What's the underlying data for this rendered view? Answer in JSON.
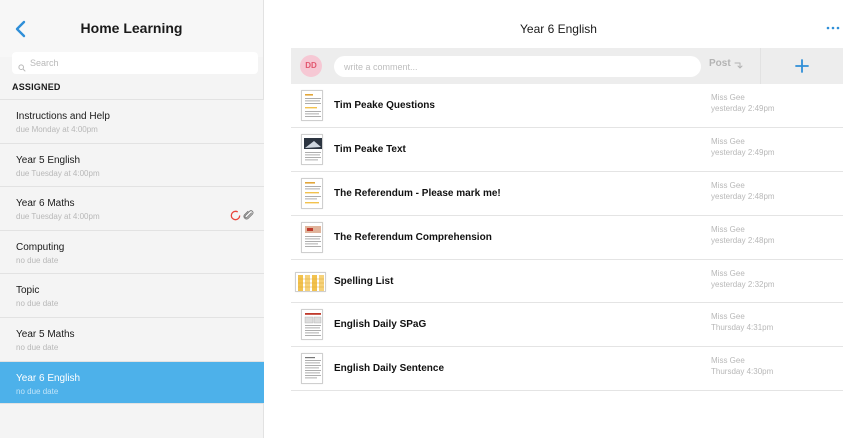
{
  "sidebar": {
    "title": "Home Learning",
    "search_placeholder": "Search",
    "section_label": "ASSIGNED",
    "items": [
      {
        "title": "Instructions and Help",
        "due": "due Monday at 4:00pm"
      },
      {
        "title": "Year 5 English",
        "due": "due Tuesday at 4:00pm"
      },
      {
        "title": "Year 6 Maths",
        "due": "due Tuesday at 4:00pm"
      },
      {
        "title": "Computing",
        "due": "no due date"
      },
      {
        "title": "Topic",
        "due": "no due date"
      },
      {
        "title": "Year 5 Maths",
        "due": "no due date"
      },
      {
        "title": "Year 6 English",
        "due": "no due date"
      }
    ]
  },
  "main": {
    "title": "Year 6 English",
    "comment": {
      "avatar_initials": "DD",
      "placeholder": "write a comment...",
      "post_label": "Post"
    },
    "files": [
      {
        "name": "Tim Peake Questions",
        "author": "Miss Gee",
        "time": "yesterday 2:49pm"
      },
      {
        "name": "Tim Peake Text",
        "author": "Miss Gee",
        "time": "yesterday 2:49pm"
      },
      {
        "name": "The Referendum - Please mark me!",
        "author": "Miss Gee",
        "time": "yesterday 2:48pm"
      },
      {
        "name": "The Referendum Comprehension",
        "author": "Miss Gee",
        "time": "yesterday 2:48pm"
      },
      {
        "name": "Spelling List",
        "author": "Miss Gee",
        "time": "yesterday 2:32pm"
      },
      {
        "name": "English Daily SPaG",
        "author": "Miss Gee",
        "time": "Thursday 4:31pm"
      },
      {
        "name": "English Daily Sentence",
        "author": "Miss Gee",
        "time": "Thursday 4:30pm"
      }
    ]
  },
  "colors": {
    "accent": "#4db1ea",
    "avatar_bg": "#f6c8d4",
    "avatar_text": "#e2566e",
    "status_ring": "#e8453c"
  }
}
